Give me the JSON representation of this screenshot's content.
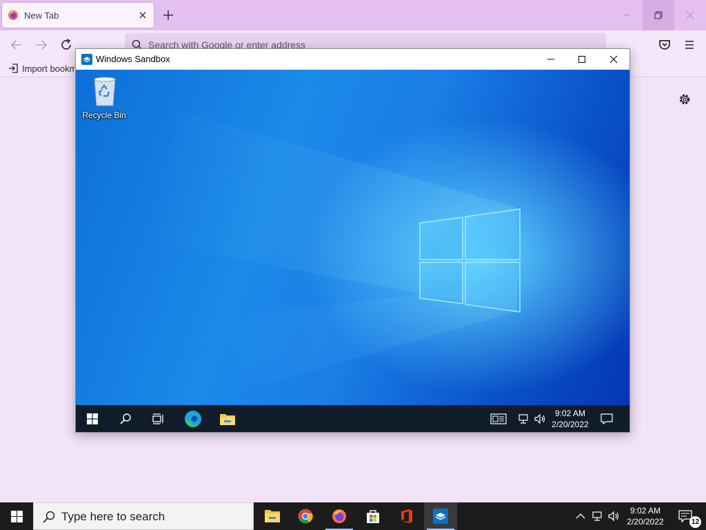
{
  "firefox": {
    "tab_title": "New Tab",
    "url_placeholder": "Search with Google or enter address",
    "bookmark_label": "Import bookm",
    "accent": "#e4bff0"
  },
  "sandbox": {
    "window_title": "Windows Sandbox",
    "desktop_icon_label": "Recycle Bin",
    "clock_time": "9:02 AM",
    "clock_date": "2/20/2022"
  },
  "taskbar": {
    "search_placeholder": "Type here to search",
    "clock_time": "9:02 AM",
    "clock_date": "2/20/2022",
    "notification_count": "12",
    "apps": [
      "file-explorer-icon",
      "chrome-icon",
      "firefox-icon",
      "microsoft-store-icon",
      "office-icon",
      "windows-sandbox-icon"
    ]
  }
}
